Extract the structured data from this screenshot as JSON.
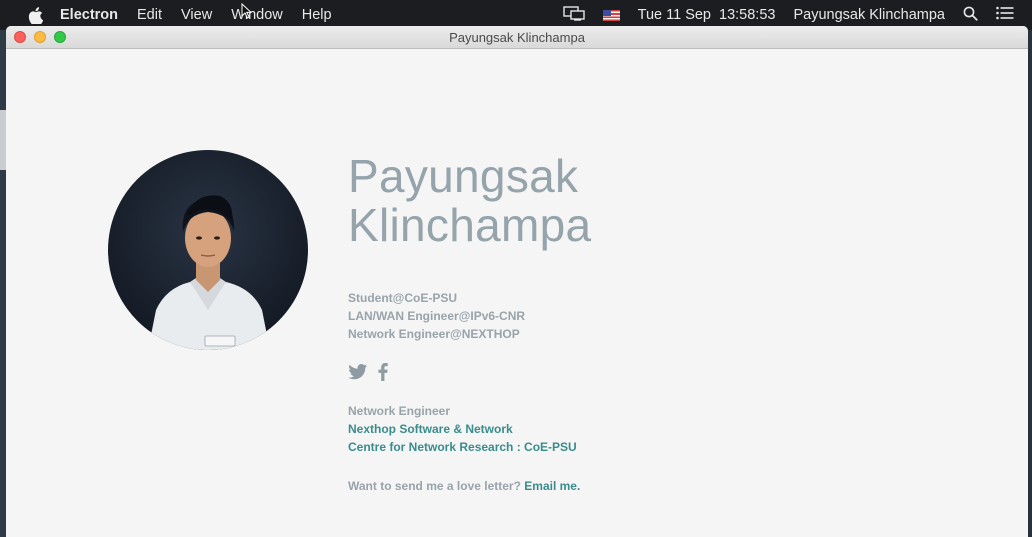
{
  "menubar": {
    "app_name": "Electron",
    "menus": [
      "Edit",
      "View",
      "Window",
      "Help"
    ],
    "date": "Tue 11 Sep",
    "time": "13:58:53",
    "user": "Payungsak Klinchampa"
  },
  "window": {
    "title": "Payungsak Klinchampa"
  },
  "profile": {
    "name_line1": "Payungsak",
    "name_line2": "Klinchampa",
    "roles": [
      "Student@CoE-PSU",
      "LAN/WAN Engineer@IPv6-CNR",
      "Network Engineer@NEXTHOP"
    ],
    "social": [
      "twitter-icon",
      "facebook-icon"
    ],
    "job_title": "Network Engineer",
    "links": [
      "Nexthop Software & Network",
      "Centre for Network Research : CoE-PSU"
    ],
    "contact_text": "Want to send me a love letter?",
    "contact_link": "Email me."
  },
  "colors": {
    "name": "#95a3ab",
    "muted_text": "#98a3aa",
    "link": "#3a8c8c",
    "background": "#f5f5f5"
  }
}
